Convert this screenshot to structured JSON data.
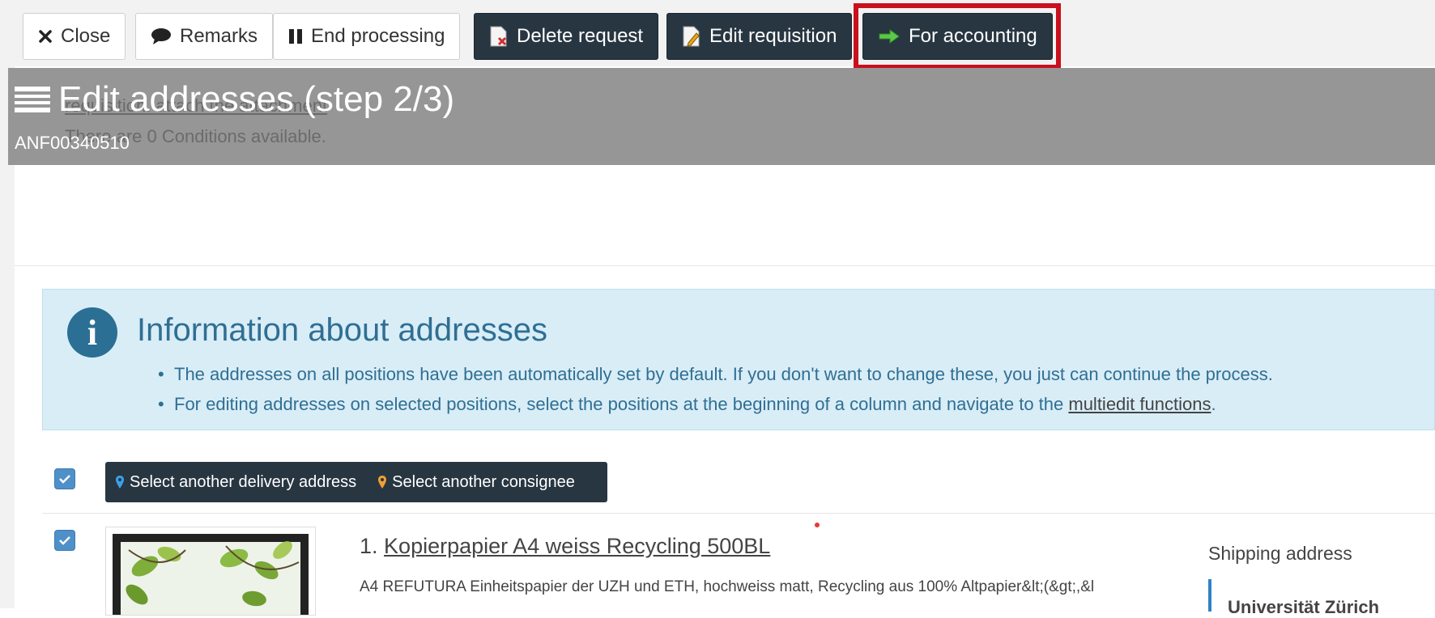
{
  "toolbar": {
    "close_label": "Close",
    "remarks_label": "Remarks",
    "end_processing_label": "End processing",
    "delete_request_label": "Delete request",
    "edit_requisition_label": "Edit requisition",
    "for_accounting_label": "For accounting"
  },
  "header": {
    "title": "Edit addresses (step 2/3)",
    "subtitle": "ANF00340510",
    "behind_text_1": "requisition. attach the attachment",
    "behind_text_2": "There are 0 Conditions available."
  },
  "info_box": {
    "title": "Information about addresses",
    "bullet_1": "The addresses on all positions have been automatically set by default. If you don't want to change these, you just can continue the process.",
    "bullet_2_prefix": "For editing addresses on selected positions, select the positions at the beginning of a column and navigate to the ",
    "bullet_2_link": "multiedit functions",
    "bullet_2_suffix": "."
  },
  "selection_bar": {
    "delivery_label": "Select another delivery address",
    "consignee_label": "Select another consignee"
  },
  "product": {
    "index": "1.",
    "name": "Kopierpapier A4 weiss Recycling 500BL",
    "description": "A4 REFUTURA Einheitspapier der UZH und ETH, hochweiss matt, Recycling aus 100% Altpapier&lt;(&gt;,&l",
    "shipping_label": "Shipping address",
    "shipping_line_1": "Universität Zürich"
  },
  "colors": {
    "dark_button": "#283642",
    "highlight": "#c8101e",
    "info_bg": "#d9edf7",
    "info_text": "#2f6f93",
    "checkbox": "#4f90c8",
    "delivery_pin": "#3aa0e8",
    "consignee_pin": "#f0a030"
  }
}
